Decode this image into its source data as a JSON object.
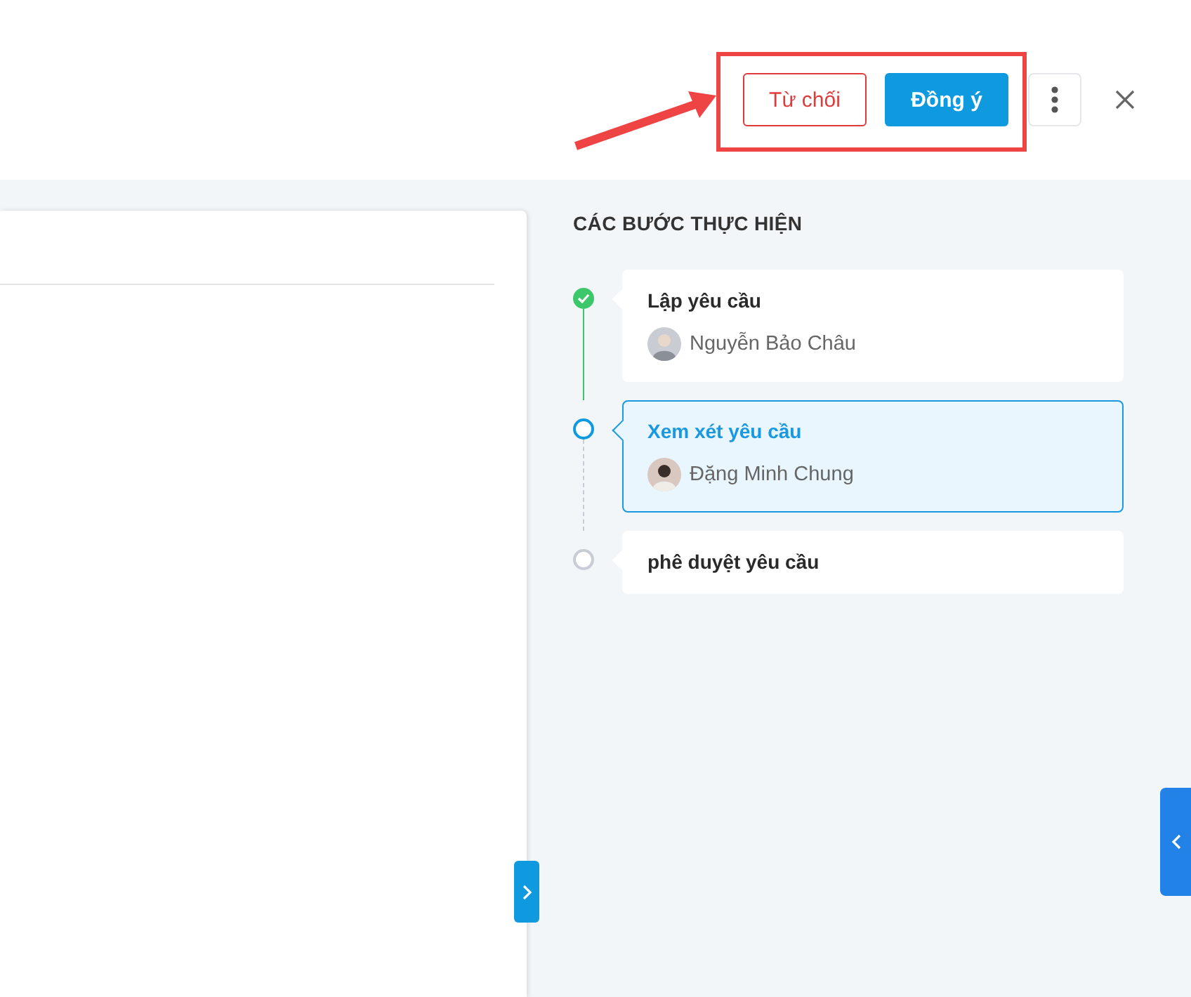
{
  "header": {
    "actions": [
      {
        "kind": "reject",
        "label": "Từ chối"
      },
      {
        "kind": "accept",
        "label": "Đồng ý"
      }
    ]
  },
  "steps_panel": {
    "title": "CÁC BƯỚC THỰC HIỆN",
    "steps": [
      {
        "title": "Lập yêu cầu",
        "kind": "done",
        "assignee": "Nguyễn Bảo Châu"
      },
      {
        "title": "Xem xét yêu cầu",
        "kind": "current",
        "assignee": "Đặng Minh Chung"
      },
      {
        "title": "phê duyệt yêu cầu",
        "kind": "pending"
      }
    ]
  }
}
